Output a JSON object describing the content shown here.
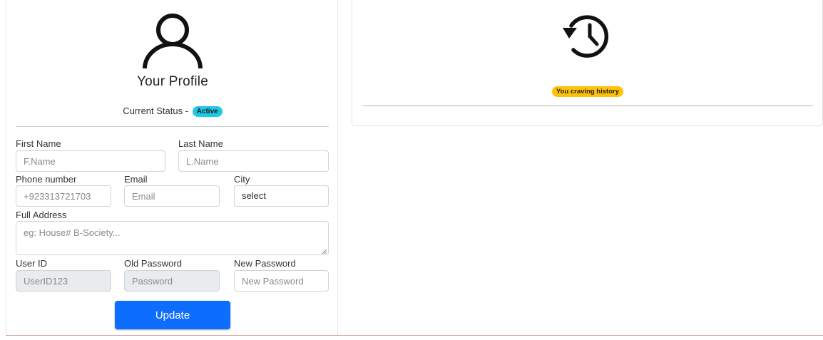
{
  "profile": {
    "title": "Your Profile",
    "status_label": "Current Status - ",
    "status_badge": "Active",
    "icon": "user-icon"
  },
  "form": {
    "first_name": {
      "label": "First Name",
      "placeholder": "F.Name"
    },
    "last_name": {
      "label": "Last Name",
      "placeholder": "L.Name"
    },
    "phone": {
      "label": "Phone number",
      "placeholder": "+923313721703"
    },
    "email": {
      "label": "Email",
      "placeholder": "Email"
    },
    "city": {
      "label": "City",
      "value": "select"
    },
    "address": {
      "label": "Full Address",
      "placeholder": "eg: House# B-Society..."
    },
    "user_id": {
      "label": "User ID",
      "placeholder": "UserID123"
    },
    "old_password": {
      "label": "Old Password",
      "placeholder": "Password"
    },
    "new_password": {
      "label": "New Password",
      "placeholder": "New Password"
    },
    "update_label": "Update"
  },
  "history": {
    "icon": "history-icon",
    "badge": "You craving history"
  },
  "colors": {
    "primary": "#0d6efd",
    "status_badge": "#1ec8e6",
    "history_badge": "#ffc107"
  }
}
